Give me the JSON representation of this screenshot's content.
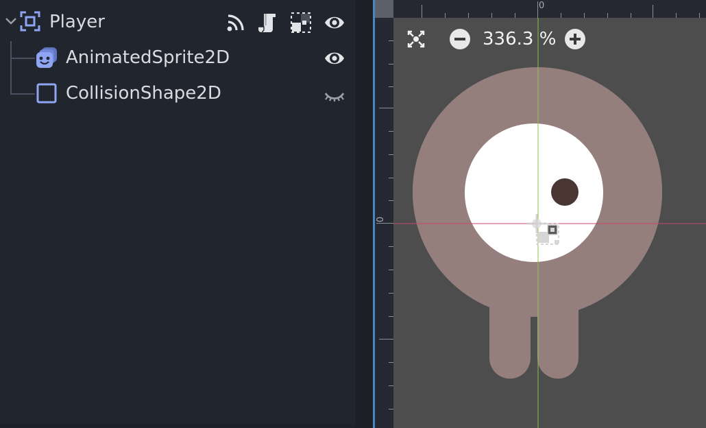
{
  "scene_tree": {
    "nodes": [
      {
        "name": "Player",
        "type_icon": "node2d-icon",
        "expanded": true
      },
      {
        "name": "AnimatedSprite2D",
        "type_icon": "animated-sprite-icon",
        "visible": true
      },
      {
        "name": "CollisionShape2D",
        "type_icon": "collision-shape-icon",
        "visible": false
      }
    ],
    "player_indicators": [
      "signal-icon",
      "script-icon",
      "group-icon",
      "visibility-icon"
    ]
  },
  "viewport": {
    "zoom_label": "336.3 %",
    "ruler_top_zero": "0",
    "ruler_left_zero": "0"
  },
  "colors": {
    "node_blue": "#8da5f3",
    "body_color": "#957f7c",
    "pupil_color": "#4a3633",
    "x_axis": "#c9466a",
    "y_axis": "#8fbf4f"
  }
}
